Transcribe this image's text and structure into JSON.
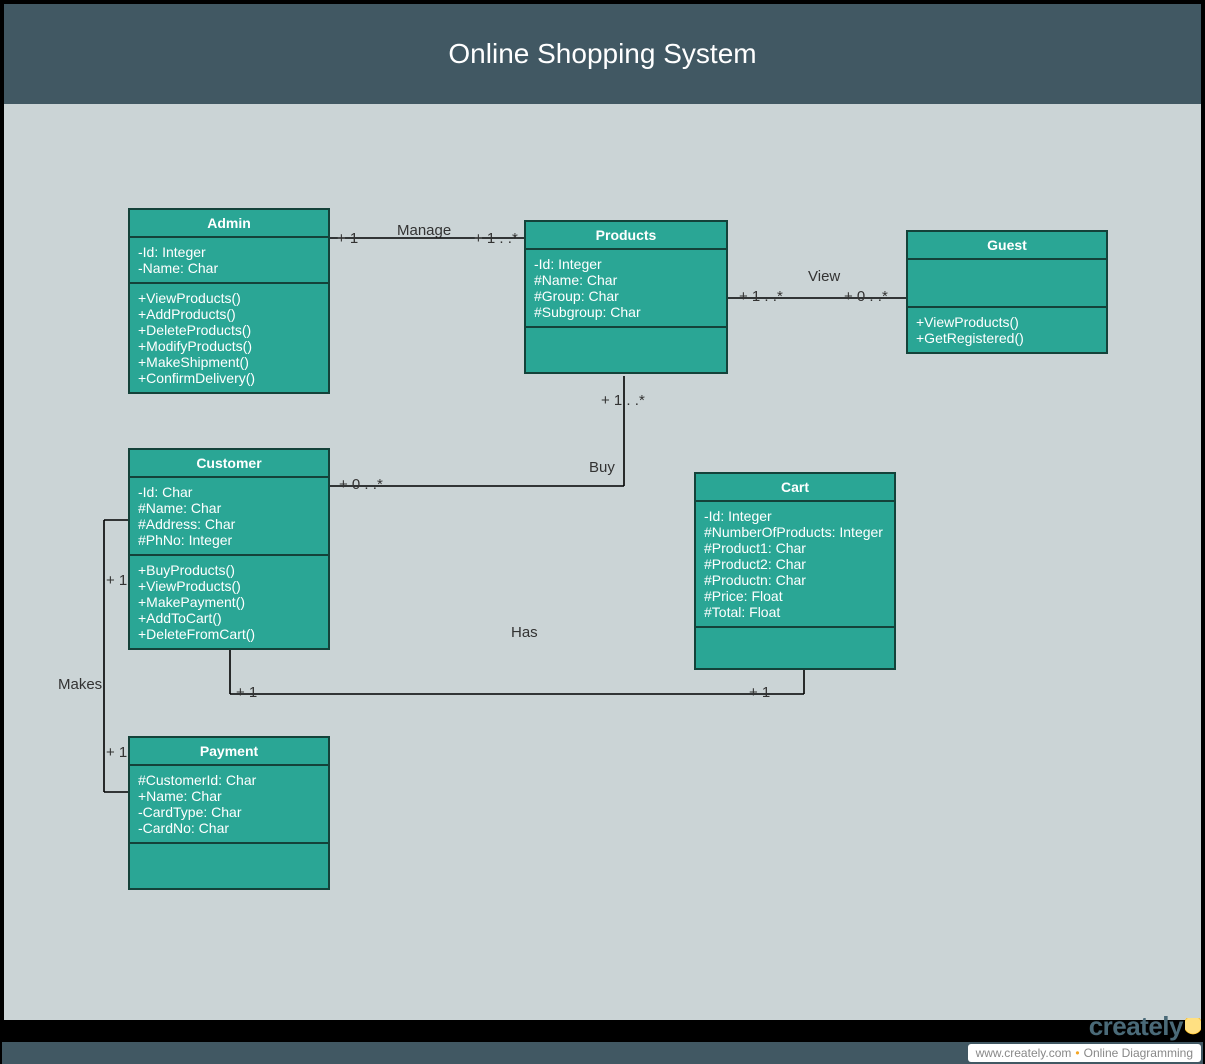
{
  "title": "Online Shopping System",
  "colors": {
    "header": "#415863",
    "class_fill": "#2aa695",
    "class_border": "#14423a",
    "canvas": "#cbd4d6"
  },
  "classes": {
    "admin": {
      "name": "Admin",
      "attributes": [
        "-Id: Integer",
        "-Name: Char"
      ],
      "methods": [
        "+ViewProducts()",
        "+AddProducts()",
        "+DeleteProducts()",
        "+ModifyProducts()",
        "+MakeShipment()",
        "+ConfirmDelivery()"
      ]
    },
    "products": {
      "name": "Products",
      "attributes": [
        "-Id: Integer",
        "#Name: Char",
        "#Group: Char",
        "#Subgroup: Char"
      ],
      "methods": []
    },
    "guest": {
      "name": "Guest",
      "attributes": [],
      "methods": [
        "+ViewProducts()",
        "+GetRegistered()"
      ]
    },
    "customer": {
      "name": "Customer",
      "attributes": [
        "-Id: Char",
        "#Name: Char",
        "#Address: Char",
        "#PhNo: Integer"
      ],
      "methods": [
        "+BuyProducts()",
        "+ViewProducts()",
        "+MakePayment()",
        "+AddToCart()",
        "+DeleteFromCart()"
      ]
    },
    "cart": {
      "name": "Cart",
      "attributes": [
        "-Id: Integer",
        "#NumberOfProducts: Integer",
        "#Product1: Char",
        "#Product2: Char",
        "#Productn: Char",
        "#Price: Float",
        "#Total: Float"
      ],
      "methods": []
    },
    "payment": {
      "name": "Payment",
      "attributes": [
        "#CustomerId: Char",
        "+Name: Char",
        "-CardType: Char",
        "-CardNo: Char"
      ],
      "methods": []
    }
  },
  "relations": {
    "manage": {
      "label": "Manage",
      "left_mult": "+ 1",
      "right_mult": "+ 1 . .*"
    },
    "view": {
      "label": "View",
      "left_mult": "+ 1 . .*",
      "right_mult": "+ 0 . .*"
    },
    "buy": {
      "label": "Buy",
      "top_mult": "+ 1 . .*",
      "bottom_mult": "+ 0 . .*"
    },
    "has": {
      "label": "Has",
      "left_mult": "+ 1",
      "right_mult": "+ 1"
    },
    "makes": {
      "label": "Makes",
      "top_mult": "+ 1",
      "bottom_mult": "+ 1"
    }
  },
  "footer": {
    "brand": "creately",
    "site": "www.creately.com",
    "separator": "•",
    "tag": "Online Diagramming"
  }
}
